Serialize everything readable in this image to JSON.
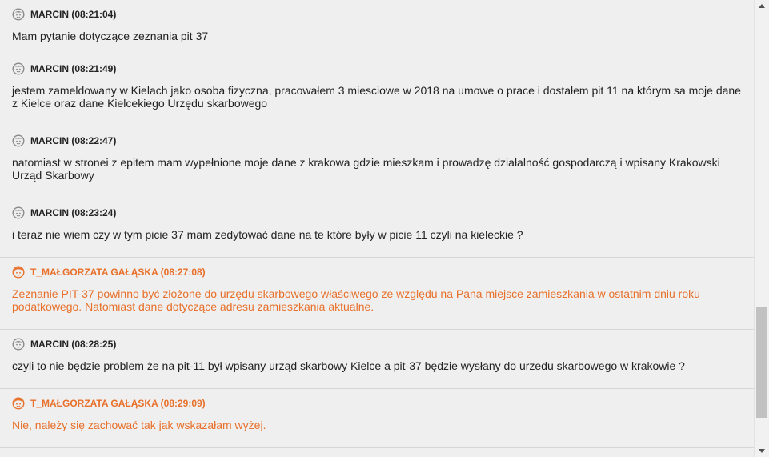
{
  "colors": {
    "user": "#222222",
    "agent": "#e8702a",
    "user_avatar": "#8a8a8a",
    "agent_avatar": "#e8702a"
  },
  "messages": [
    {
      "role": "user",
      "avatar_icon": "user-avatar-icon",
      "author": "MARCIN (08:21:04)",
      "text": "Mam pytanie dotyczące zeznania pit 37"
    },
    {
      "role": "user",
      "avatar_icon": "user-avatar-icon",
      "author": "MARCIN (08:21:49)",
      "text": "jestem zameldowany w Kielach jako osoba fizyczna, pracowałem 3 miesciowe w 2018 na umowe o prace i dostałem pit 11 na którym sa moje dane z Kielce oraz dane Kielcekiego Urzędu skarbowego"
    },
    {
      "role": "user",
      "avatar_icon": "user-avatar-icon",
      "author": "MARCIN (08:22:47)",
      "text": "natomiast w stronei z epitem mam wypełnione moje dane z krakowa gdzie mieszkam i prowadzę działalność gospodarczą i wpisany Krakowski Urząd Skarbowy"
    },
    {
      "role": "user",
      "avatar_icon": "user-avatar-icon",
      "author": "MARCIN (08:23:24)",
      "text": "i teraz nie wiem czy w tym picie 37 mam zedytować dane na te które były w picie 11 czyli na kieleckie ?"
    },
    {
      "role": "agent",
      "avatar_icon": "agent-avatar-icon",
      "author": "T_MAŁGORZATA GAŁĄSKA (08:27:08)",
      "text": "Zeznanie PIT-37 powinno być złożone do urzędu skarbowego właściwego ze względu na Pana miejsce zamieszkania w ostatnim dniu roku podatkowego. Natomiast dane dotyczące adresu zamieszkania aktualne."
    },
    {
      "role": "user",
      "avatar_icon": "user-avatar-icon",
      "author": "MARCIN (08:28:25)",
      "text": "czyli to nie będzie problem że na pit-11 był wpisany urząd skarbowy Kielce a pit-37 będzie wysłany do urzedu skarbowego w krakowie ?"
    },
    {
      "role": "agent",
      "avatar_icon": "agent-avatar-icon",
      "author": "T_MAŁGORZATA GAŁĄSKA (08:29:09)",
      "text": "Nie, należy się zachować tak jak wskazałam wyżej."
    }
  ],
  "scrollbar": {
    "up_icon": "arrow-up-icon",
    "down_icon": "arrow-down-icon",
    "position": 0.82
  }
}
